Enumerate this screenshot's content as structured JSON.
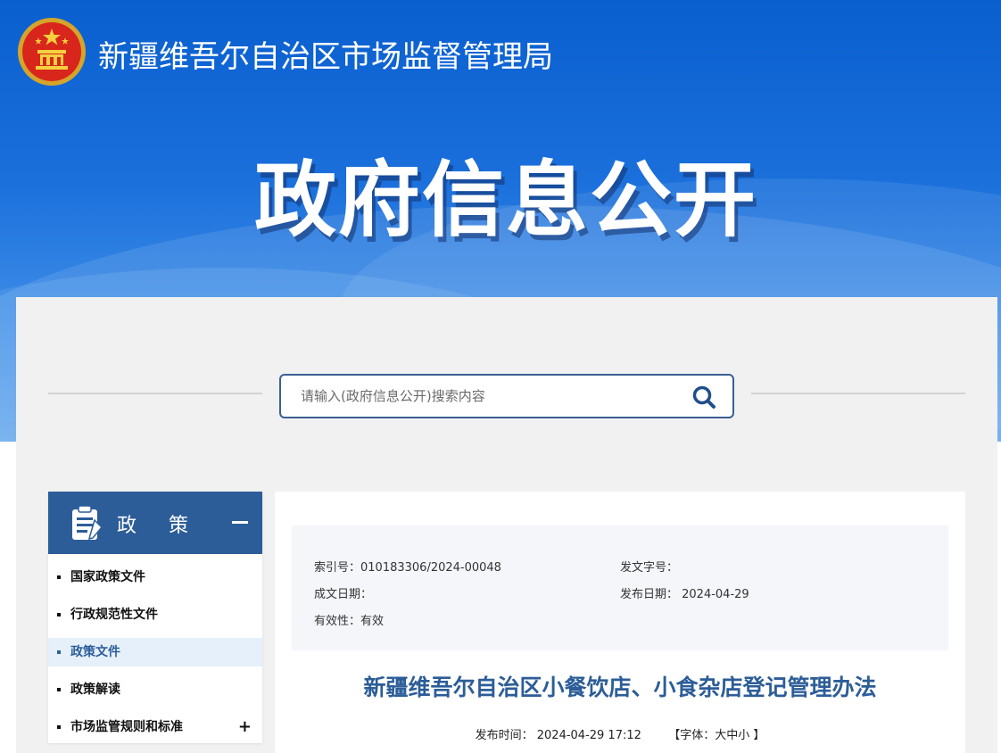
{
  "header": {
    "site_title": "新疆维吾尔自治区市场监督管理局",
    "hero_title": "政府信息公开"
  },
  "search": {
    "placeholder": "请输入(政府信息公开)搜索内容"
  },
  "sidebar": {
    "heading": "政策",
    "items": [
      {
        "label": "国家政策文件"
      },
      {
        "label": "行政规范性文件"
      },
      {
        "label": "政策文件"
      },
      {
        "label": "政策解读"
      },
      {
        "label": "市场监管规则和标准"
      }
    ]
  },
  "meta": {
    "index_no": "索引号：010183306/2024-00048",
    "doc_no": "发文字号：",
    "written_date": "成文日期：",
    "publish_date": "发布日期： 2024-04-29",
    "validity": "有效性：有效"
  },
  "article": {
    "title": "新疆维吾尔自治区小餐饮店、小食杂店登记管理办法",
    "publish_time_label": "发布时间：",
    "publish_time": "2024-04-29 17:12",
    "font_label_open": "【字体：",
    "font_large": "大",
    "font_medium": "中",
    "font_small": "小",
    "font_label_close": " 】"
  },
  "colors": {
    "brand_blue": "#2c5d98",
    "banner_blue": "#0a5fcf"
  }
}
